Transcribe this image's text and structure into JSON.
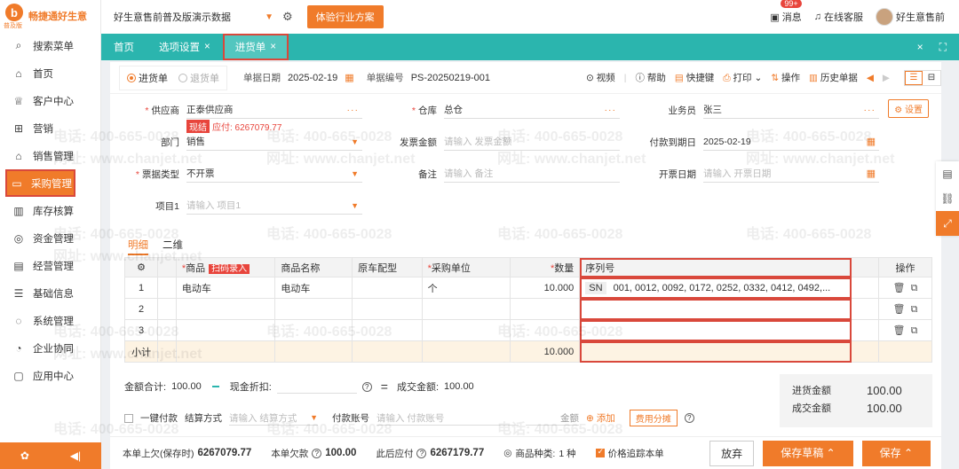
{
  "sidebar": {
    "logo_text": "畅捷通好生意",
    "logo_sub": "普及版",
    "items": [
      {
        "label": "搜索菜单",
        "icon": "search-icon",
        "glyph": "⌕"
      },
      {
        "label": "首页",
        "icon": "home-icon",
        "glyph": "⌂"
      },
      {
        "label": "客户中心",
        "icon": "trophy-icon",
        "glyph": "♕"
      },
      {
        "label": "营销",
        "icon": "gift-icon",
        "glyph": "⊞"
      },
      {
        "label": "销售管理",
        "icon": "sales-icon",
        "glyph": "⌂"
      },
      {
        "label": "采购管理",
        "icon": "cart-icon",
        "glyph": "▭"
      },
      {
        "label": "库存核算",
        "icon": "warehouse-icon",
        "glyph": "▥"
      },
      {
        "label": "资金管理",
        "icon": "money-icon",
        "glyph": "◎"
      },
      {
        "label": "经营管理",
        "icon": "report-icon",
        "glyph": "▤"
      },
      {
        "label": "基础信息",
        "icon": "info-icon",
        "glyph": "☰"
      },
      {
        "label": "系统管理",
        "icon": "system-icon",
        "glyph": "◌"
      },
      {
        "label": "企业协同",
        "icon": "collab-icon",
        "glyph": "◔"
      },
      {
        "label": "应用中心",
        "icon": "apps-icon",
        "glyph": "▢"
      }
    ],
    "active_index": 5
  },
  "topbar": {
    "org_name": "好生意售前普及版演示数据",
    "trial_button": "体验行业方案",
    "messages_label": "消息",
    "messages_badge": "99+",
    "support_label": "在线客服",
    "user_name": "好生意售前"
  },
  "tabs": [
    {
      "label": "首页",
      "closable": false
    },
    {
      "label": "选项设置",
      "closable": true
    },
    {
      "label": "进货单",
      "closable": true,
      "current": true
    }
  ],
  "toolbar": {
    "radio_on": "进货单",
    "radio_off": "退货单",
    "date_label": "单据日期",
    "date_value": "2025-02-19",
    "no_label": "单据编号",
    "no_value": "PS-20250219-001",
    "video": "视频",
    "help": "帮助",
    "shortcut": "快捷键",
    "print": "打印",
    "operate": "操作",
    "history": "历史单据"
  },
  "form": {
    "supplier_label": "供应商",
    "supplier_value": "正泰供应商",
    "supplier_tag": "现结",
    "supplier_payable": "应付: 6267079.77",
    "warehouse_label": "仓库",
    "warehouse_value": "总仓",
    "clerk_label": "业务员",
    "clerk_value": "张三",
    "settings_button": "设置",
    "dept_label": "部门",
    "dept_value": "销售",
    "invoice_amount_label": "发票金额",
    "invoice_amount_placeholder": "请输入 发票金额",
    "due_label": "付款到期日",
    "due_value": "2025-02-19",
    "invoice_type_label": "票据类型",
    "invoice_type_value": "不开票",
    "remark_label": "备注",
    "remark_placeholder": "请输入 备注",
    "invoice_date_label": "开票日期",
    "invoice_date_placeholder": "请输入 开票日期",
    "project_label": "项目1",
    "project_placeholder": "请输入 项目1"
  },
  "subtabs": [
    "明细",
    "二维"
  ],
  "grid": {
    "headers": {
      "product": "商品",
      "scan": "扫码录入",
      "name": "商品名称",
      "model": "原车配型",
      "unit": "采购单位",
      "qty": "数量",
      "serial": "序列号",
      "ops": "操作"
    },
    "rows": [
      {
        "no": "1",
        "product": "电动车",
        "name": "电动车",
        "unit": "个",
        "qty": "10.000",
        "sn_tag": "SN",
        "serial": "001, 0012, 0092, 0172, 0252, 0332, 0412, 0492,..."
      },
      {
        "no": "2",
        "product": "",
        "name": "",
        "unit": "",
        "qty": "",
        "sn_tag": "",
        "serial": ""
      },
      {
        "no": "3",
        "product": "",
        "name": "",
        "unit": "",
        "qty": "",
        "sn_tag": "",
        "serial": ""
      }
    ],
    "subtotal_label": "小计",
    "subtotal_qty": "10.000"
  },
  "amounts": {
    "total_label": "金额合计:",
    "total_value": "100.00",
    "discount_label": "现金折扣:",
    "deal_label": "成交金额:",
    "deal_value": "100.00"
  },
  "payment": {
    "one_click": "一键付款",
    "method_label": "结算方式",
    "method_placeholder": "请输入 结算方式",
    "account_label": "付款账号",
    "account_placeholder": "请输入 付款账号",
    "amount_label": "金额",
    "add_label": "添加",
    "fee_button": "费用分摊"
  },
  "totals": {
    "purchase_label": "进货金额",
    "purchase_value": "100.00",
    "deal_label": "成交金额",
    "deal_value": "100.00"
  },
  "footer": {
    "prev_debt_label": "本单上欠(保存时)",
    "prev_debt_value": "6267079.77",
    "debt_label": "本单欠款",
    "debt_value": "100.00",
    "after_label": "此后应付",
    "after_value": "6267179.77",
    "kinds_label": "商品种类:",
    "kinds_value": "1 种",
    "track_label": "价格追踪本单",
    "discard": "放弃",
    "save_draft": "保存草稿",
    "save": "保存"
  },
  "watermark": {
    "phone": "电话: 400-665-0028",
    "site": "网址: www.chanjet.net"
  },
  "colors": {
    "accent": "#f07b2a",
    "teal": "#2bb5ae",
    "highlight": "#d9483b"
  }
}
